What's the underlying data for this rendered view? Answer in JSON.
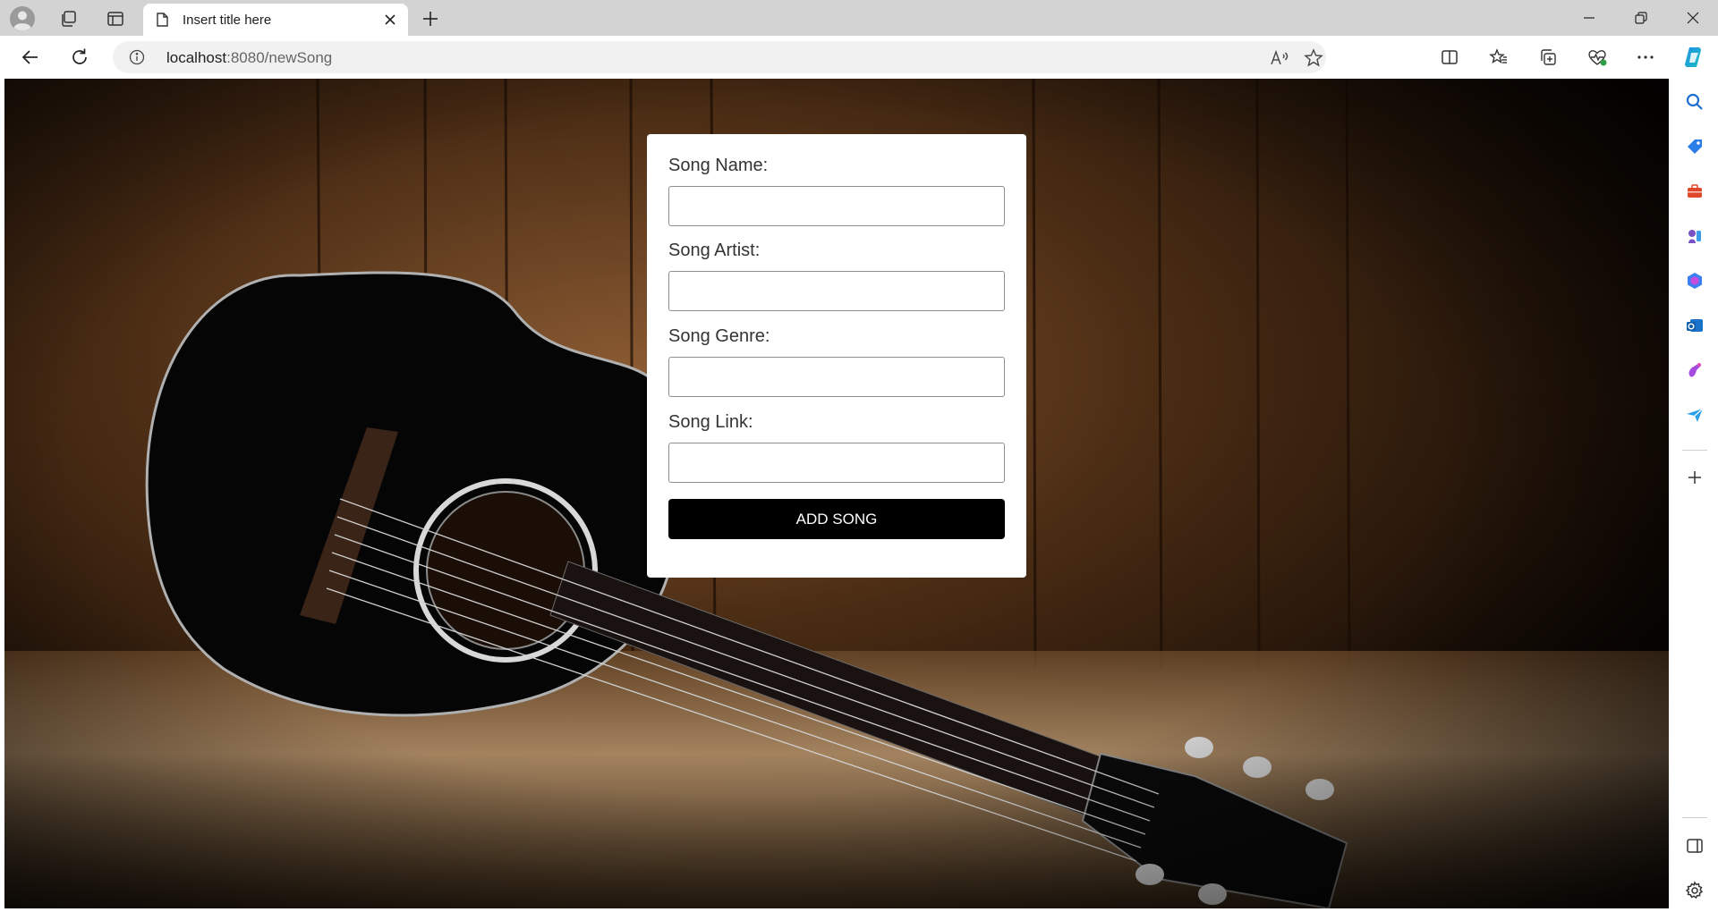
{
  "browser": {
    "tab_title": "Insert title here",
    "url_host": "localhost",
    "url_path": ":8080/newSong",
    "icons": {
      "profile": "profile-icon",
      "workspaces": "workspaces-icon",
      "tab_actions": "vertical-tabs-icon",
      "tab_page": "page-icon",
      "tab_close": "close-icon",
      "new_tab": "plus-icon",
      "minimize": "minimize-icon",
      "restore": "restore-icon",
      "close_window": "close-icon",
      "back": "back-arrow-icon",
      "refresh": "refresh-icon",
      "site_info": "info-icon",
      "read_aloud": "read-aloud-icon",
      "favorite": "star-icon",
      "split_screen": "split-screen-icon",
      "favorites": "favorites-icon",
      "collections": "collections-icon",
      "browser_essentials": "heart-pulse-icon",
      "more": "more-icon",
      "copilot": "copilot-icon"
    }
  },
  "sidebar": {
    "items": [
      "search-icon",
      "shopping-tag-icon",
      "tools-icon",
      "games-icon",
      "microsoft-365-icon",
      "outlook-icon",
      "designer-icon",
      "send-icon",
      "add-icon",
      "sidebar-toggle-icon",
      "settings-icon"
    ]
  },
  "form": {
    "song_name_label": "Song Name:",
    "song_artist_label": "Song Artist:",
    "song_genre_label": "Song Genre:",
    "song_link_label": "Song Link:",
    "song_name_value": "",
    "song_artist_value": "",
    "song_genre_value": "",
    "song_link_value": "",
    "submit_label": "ADD SONG"
  },
  "colors": {
    "browser_frame": "#d3d3d3",
    "button_bg": "#000000",
    "button_text": "#ffffff",
    "card_bg": "#ffffff",
    "copilot_accent": "#1f8fe8"
  }
}
